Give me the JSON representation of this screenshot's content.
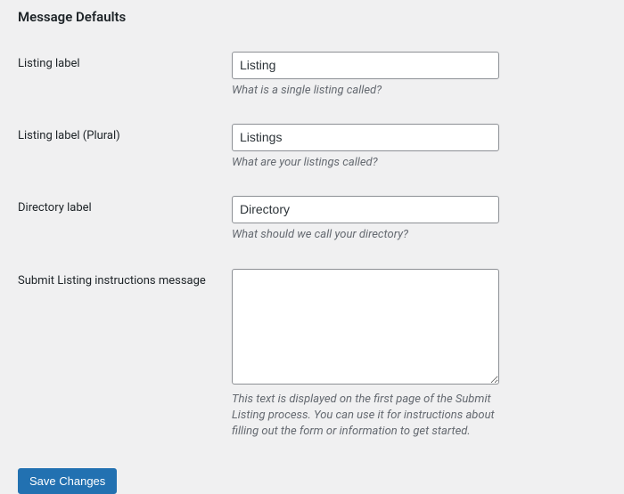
{
  "page": {
    "title": "Message Defaults"
  },
  "fields": {
    "listing_label": {
      "label": "Listing label",
      "value": "Listing",
      "description": "What is a single listing called?"
    },
    "listing_label_plural": {
      "label": "Listing label (Plural)",
      "value": "Listings",
      "description": "What are your listings called?"
    },
    "directory_label": {
      "label": "Directory label",
      "value": "Directory",
      "description": "What should we call your directory?"
    },
    "submit_instructions": {
      "label": "Submit Listing instructions message",
      "value": "",
      "description": "This text is displayed on the first page of the Submit Listing process. You can use it for instructions about filling out the form or information to get started."
    }
  },
  "actions": {
    "save_label": "Save Changes"
  }
}
